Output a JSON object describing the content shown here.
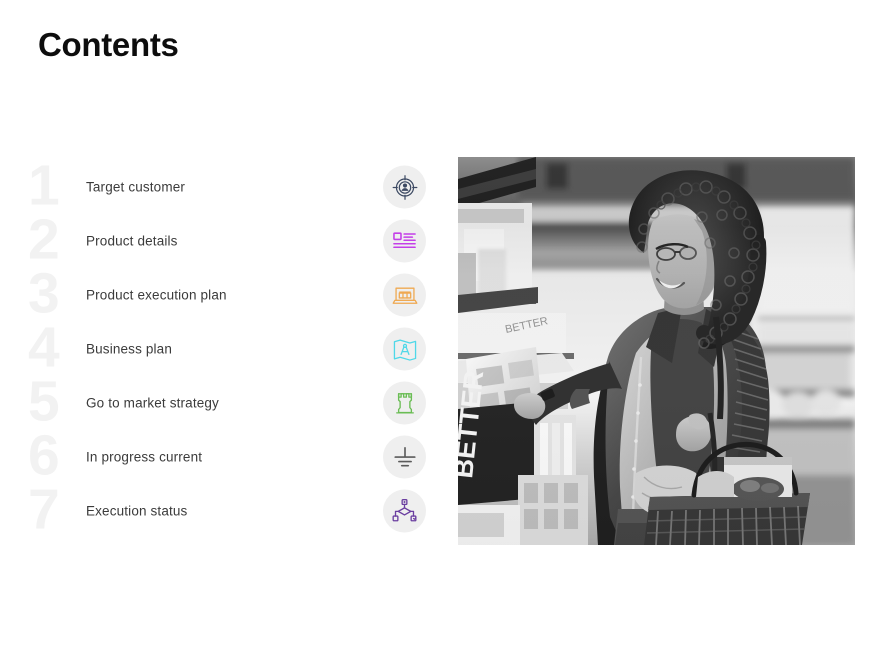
{
  "slide": {
    "title": "Contents",
    "background_color": "#ffffff"
  },
  "contents": {
    "items": [
      {
        "number": "1",
        "label": "Target customer",
        "icon": "target-person-icon",
        "icon_color": "#3d4a63",
        "icon_bg": "#efefef"
      },
      {
        "number": "2",
        "label": "Product details",
        "icon": "document-details-icon",
        "icon_color": "#c43fe8",
        "icon_bg": "#efefef"
      },
      {
        "number": "3",
        "label": "Product execution plan",
        "icon": "laptop-storefront-icon",
        "icon_color": "#efa952",
        "icon_bg": "#efefef"
      },
      {
        "number": "4",
        "label": "Business plan",
        "icon": "blueprint-compass-icon",
        "icon_color": "#4fd8e8",
        "icon_bg": "#efefef"
      },
      {
        "number": "5",
        "label": "Go to market strategy",
        "icon": "chess-rook-icon",
        "icon_color": "#6bbd55",
        "icon_bg": "#efefef"
      },
      {
        "number": "6",
        "label": "In progress current",
        "icon": "ground-symbol-icon",
        "icon_color": "#5b5b5b",
        "icon_bg": "#efefef"
      },
      {
        "number": "7",
        "label": "Execution status",
        "icon": "workflow-nodes-icon",
        "icon_color": "#6b3fa0",
        "icon_bg": "#efefef"
      }
    ]
  },
  "photo": {
    "name": "woman-shopping-grocery-store-photo",
    "description": "Black and white photograph of a smiling woman with curly hair shopping in a grocery store, holding a shopping basket and reaching for a product on a shelf",
    "style": "grayscale"
  }
}
